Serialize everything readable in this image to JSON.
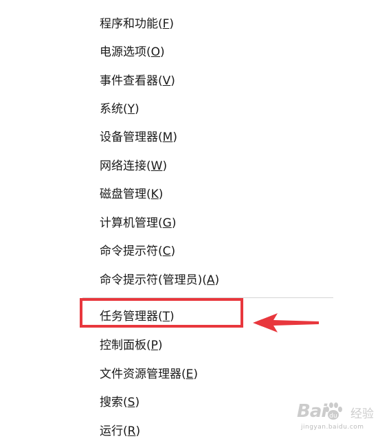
{
  "menu": {
    "items": [
      {
        "label": "程序和功能",
        "key": "F"
      },
      {
        "label": "电源选项",
        "key": "O"
      },
      {
        "label": "事件查看器",
        "key": "V"
      },
      {
        "label": "系统",
        "key": "Y"
      },
      {
        "label": "设备管理器",
        "key": "M"
      },
      {
        "label": "网络连接",
        "key": "W"
      },
      {
        "label": "磁盘管理",
        "key": "K"
      },
      {
        "label": "计算机管理",
        "key": "G"
      },
      {
        "label": "命令提示符",
        "key": "C"
      },
      {
        "label": "命令提示符(管理员)",
        "key": "A"
      },
      {
        "label": "任务管理器",
        "key": "T"
      },
      {
        "label": "控制面板",
        "key": "P"
      },
      {
        "label": "文件资源管理器",
        "key": "E"
      },
      {
        "label": "搜索",
        "key": "S"
      },
      {
        "label": "运行",
        "key": "R"
      }
    ],
    "highlighted_item": "任务管理器"
  },
  "annotation": {
    "highlight_color": "#e8373d",
    "arrow_color": "#e8373d"
  },
  "watermark": {
    "logo_text": "Bai",
    "cn_text": "经验",
    "url": "jingyan.baidu.com"
  }
}
